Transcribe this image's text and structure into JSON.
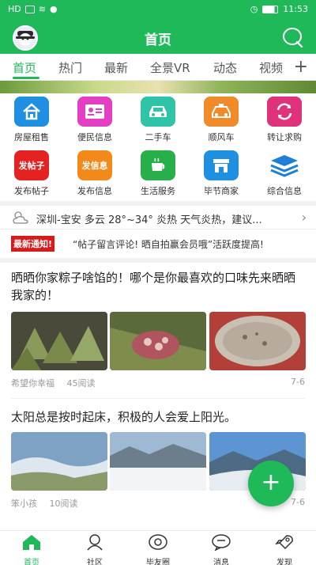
{
  "status_bar": {
    "left": "HD",
    "time": "11:53"
  },
  "header": {
    "title": "首页"
  },
  "tabs": [
    {
      "label": "首页"
    },
    {
      "label": "热门"
    },
    {
      "label": "最新"
    },
    {
      "label": "全景VR"
    },
    {
      "label": "动态"
    },
    {
      "label": "视频"
    }
  ],
  "grid": [
    {
      "label": "房屋租售",
      "icon": "house-icon",
      "color": "#1e8fe1",
      "icon_text": ""
    },
    {
      "label": "便民信息",
      "icon": "id-card-icon",
      "color": "#e43ec3",
      "icon_text": ""
    },
    {
      "label": "二手车",
      "icon": "car-icon",
      "color": "#2fc4a8",
      "icon_text": ""
    },
    {
      "label": "顺风车",
      "icon": "taxi-icon",
      "color": "#f08b2a",
      "icon_text": ""
    },
    {
      "label": "转让求购",
      "icon": "swap-icon",
      "color": "#e0317b",
      "icon_text": ""
    },
    {
      "label": "发布帖子",
      "icon": "post-icon",
      "color": "#e42222",
      "icon_text": "发帖子"
    },
    {
      "label": "发布信息",
      "icon": "info-icon",
      "color": "#f28a1b",
      "icon_text": "发信息"
    },
    {
      "label": "生活服务",
      "icon": "coffee-icon",
      "color": "#27b04a",
      "icon_text": ""
    },
    {
      "label": "毕节商家",
      "icon": "shop-icon",
      "color": "#1e8fe1",
      "icon_text": ""
    },
    {
      "label": "综合信息",
      "icon": "layers-icon",
      "color": "#1e7fd6",
      "icon_text": ""
    }
  ],
  "weather": {
    "text": "深圳-宝安 多云 28°~34° 炎热 天气炎热，建议..."
  },
  "notice": {
    "badge": "最新通知!",
    "text": "“帖子留言评论! 晒自拍赢会员哦”活跃度提高!"
  },
  "posts": [
    {
      "title": "晒晒你家粽子啥馅的！哪个是你最喜欢的口味先来晒晒我家的！",
      "author": "希望你幸福",
      "reads": "45阅读",
      "date": "7-6"
    },
    {
      "title": "太阳总是按时起床，积极的人会爱上阳光。",
      "author": "笨小孩",
      "reads": "10阅读",
      "date": "7-6"
    }
  ],
  "fab": {
    "label": "+"
  },
  "bottom_nav": [
    {
      "label": "首页"
    },
    {
      "label": "社区"
    },
    {
      "label": "毕友圈"
    },
    {
      "label": "消息"
    },
    {
      "label": "发现"
    }
  ],
  "colors": {
    "primary": "#1fb95a",
    "notice_red": "#d91a1a"
  }
}
